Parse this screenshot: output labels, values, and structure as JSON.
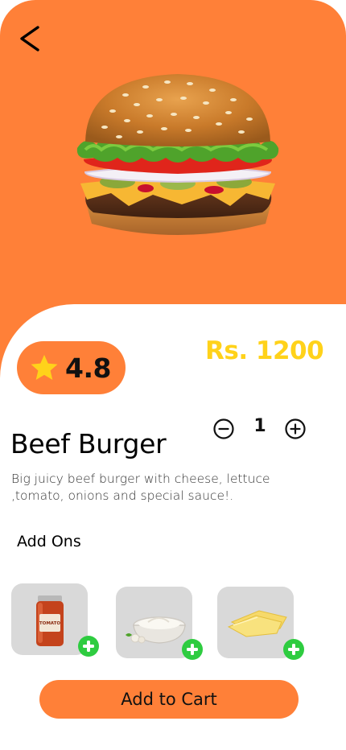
{
  "colors": {
    "accent": "#FF8038",
    "price": "#FFD21A",
    "star": "#FFD21A",
    "card": "#D9D9D9",
    "add_icon": "#2ECC40"
  },
  "icons": {
    "back": "chevron-left-icon",
    "rating": "star-icon",
    "decrement": "minus-circle-icon",
    "increment": "plus-circle-icon",
    "addon_add": "plus-circle-filled-icon"
  },
  "product": {
    "rating": "4.8",
    "price": "Rs. 1200",
    "name": "Beef Burger",
    "description": "Big juicy beef burger with cheese, lettuce ,tomato, onions and special sauce!.",
    "quantity": "1"
  },
  "addons": {
    "heading": "Add Ons",
    "items": [
      {
        "id": "tomato-sauce-jar",
        "jar_label": "TOMATO"
      },
      {
        "id": "mayonnaise-bowl"
      },
      {
        "id": "cheese-slices"
      }
    ]
  },
  "cart": {
    "button_label": "Add to Cart"
  }
}
